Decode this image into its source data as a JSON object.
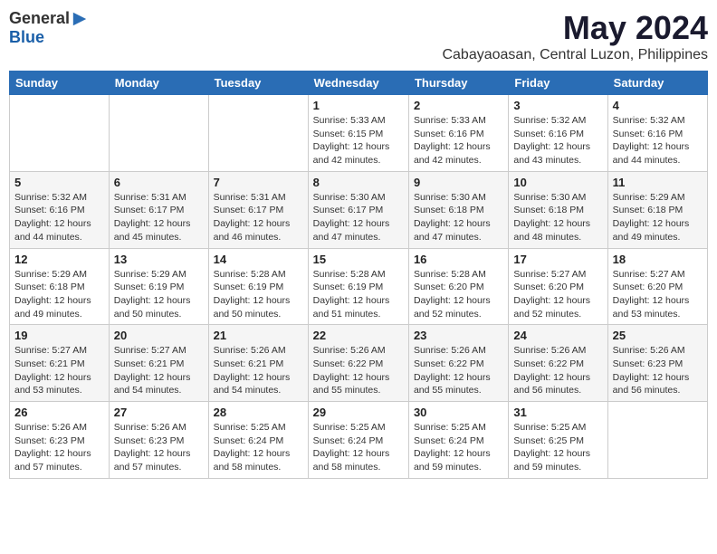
{
  "logo": {
    "general": "General",
    "blue": "Blue"
  },
  "title": "May 2024",
  "location": "Cabayaoasan, Central Luzon, Philippines",
  "weekdays": [
    "Sunday",
    "Monday",
    "Tuesday",
    "Wednesday",
    "Thursday",
    "Friday",
    "Saturday"
  ],
  "weeks": [
    [
      {
        "day": "",
        "sunrise": "",
        "sunset": "",
        "daylight": ""
      },
      {
        "day": "",
        "sunrise": "",
        "sunset": "",
        "daylight": ""
      },
      {
        "day": "",
        "sunrise": "",
        "sunset": "",
        "daylight": ""
      },
      {
        "day": "1",
        "sunrise": "Sunrise: 5:33 AM",
        "sunset": "Sunset: 6:15 PM",
        "daylight": "Daylight: 12 hours and 42 minutes."
      },
      {
        "day": "2",
        "sunrise": "Sunrise: 5:33 AM",
        "sunset": "Sunset: 6:16 PM",
        "daylight": "Daylight: 12 hours and 42 minutes."
      },
      {
        "day": "3",
        "sunrise": "Sunrise: 5:32 AM",
        "sunset": "Sunset: 6:16 PM",
        "daylight": "Daylight: 12 hours and 43 minutes."
      },
      {
        "day": "4",
        "sunrise": "Sunrise: 5:32 AM",
        "sunset": "Sunset: 6:16 PM",
        "daylight": "Daylight: 12 hours and 44 minutes."
      }
    ],
    [
      {
        "day": "5",
        "sunrise": "Sunrise: 5:32 AM",
        "sunset": "Sunset: 6:16 PM",
        "daylight": "Daylight: 12 hours and 44 minutes."
      },
      {
        "day": "6",
        "sunrise": "Sunrise: 5:31 AM",
        "sunset": "Sunset: 6:17 PM",
        "daylight": "Daylight: 12 hours and 45 minutes."
      },
      {
        "day": "7",
        "sunrise": "Sunrise: 5:31 AM",
        "sunset": "Sunset: 6:17 PM",
        "daylight": "Daylight: 12 hours and 46 minutes."
      },
      {
        "day": "8",
        "sunrise": "Sunrise: 5:30 AM",
        "sunset": "Sunset: 6:17 PM",
        "daylight": "Daylight: 12 hours and 47 minutes."
      },
      {
        "day": "9",
        "sunrise": "Sunrise: 5:30 AM",
        "sunset": "Sunset: 6:18 PM",
        "daylight": "Daylight: 12 hours and 47 minutes."
      },
      {
        "day": "10",
        "sunrise": "Sunrise: 5:30 AM",
        "sunset": "Sunset: 6:18 PM",
        "daylight": "Daylight: 12 hours and 48 minutes."
      },
      {
        "day": "11",
        "sunrise": "Sunrise: 5:29 AM",
        "sunset": "Sunset: 6:18 PM",
        "daylight": "Daylight: 12 hours and 49 minutes."
      }
    ],
    [
      {
        "day": "12",
        "sunrise": "Sunrise: 5:29 AM",
        "sunset": "Sunset: 6:18 PM",
        "daylight": "Daylight: 12 hours and 49 minutes."
      },
      {
        "day": "13",
        "sunrise": "Sunrise: 5:29 AM",
        "sunset": "Sunset: 6:19 PM",
        "daylight": "Daylight: 12 hours and 50 minutes."
      },
      {
        "day": "14",
        "sunrise": "Sunrise: 5:28 AM",
        "sunset": "Sunset: 6:19 PM",
        "daylight": "Daylight: 12 hours and 50 minutes."
      },
      {
        "day": "15",
        "sunrise": "Sunrise: 5:28 AM",
        "sunset": "Sunset: 6:19 PM",
        "daylight": "Daylight: 12 hours and 51 minutes."
      },
      {
        "day": "16",
        "sunrise": "Sunrise: 5:28 AM",
        "sunset": "Sunset: 6:20 PM",
        "daylight": "Daylight: 12 hours and 52 minutes."
      },
      {
        "day": "17",
        "sunrise": "Sunrise: 5:27 AM",
        "sunset": "Sunset: 6:20 PM",
        "daylight": "Daylight: 12 hours and 52 minutes."
      },
      {
        "day": "18",
        "sunrise": "Sunrise: 5:27 AM",
        "sunset": "Sunset: 6:20 PM",
        "daylight": "Daylight: 12 hours and 53 minutes."
      }
    ],
    [
      {
        "day": "19",
        "sunrise": "Sunrise: 5:27 AM",
        "sunset": "Sunset: 6:21 PM",
        "daylight": "Daylight: 12 hours and 53 minutes."
      },
      {
        "day": "20",
        "sunrise": "Sunrise: 5:27 AM",
        "sunset": "Sunset: 6:21 PM",
        "daylight": "Daylight: 12 hours and 54 minutes."
      },
      {
        "day": "21",
        "sunrise": "Sunrise: 5:26 AM",
        "sunset": "Sunset: 6:21 PM",
        "daylight": "Daylight: 12 hours and 54 minutes."
      },
      {
        "day": "22",
        "sunrise": "Sunrise: 5:26 AM",
        "sunset": "Sunset: 6:22 PM",
        "daylight": "Daylight: 12 hours and 55 minutes."
      },
      {
        "day": "23",
        "sunrise": "Sunrise: 5:26 AM",
        "sunset": "Sunset: 6:22 PM",
        "daylight": "Daylight: 12 hours and 55 minutes."
      },
      {
        "day": "24",
        "sunrise": "Sunrise: 5:26 AM",
        "sunset": "Sunset: 6:22 PM",
        "daylight": "Daylight: 12 hours and 56 minutes."
      },
      {
        "day": "25",
        "sunrise": "Sunrise: 5:26 AM",
        "sunset": "Sunset: 6:23 PM",
        "daylight": "Daylight: 12 hours and 56 minutes."
      }
    ],
    [
      {
        "day": "26",
        "sunrise": "Sunrise: 5:26 AM",
        "sunset": "Sunset: 6:23 PM",
        "daylight": "Daylight: 12 hours and 57 minutes."
      },
      {
        "day": "27",
        "sunrise": "Sunrise: 5:26 AM",
        "sunset": "Sunset: 6:23 PM",
        "daylight": "Daylight: 12 hours and 57 minutes."
      },
      {
        "day": "28",
        "sunrise": "Sunrise: 5:25 AM",
        "sunset": "Sunset: 6:24 PM",
        "daylight": "Daylight: 12 hours and 58 minutes."
      },
      {
        "day": "29",
        "sunrise": "Sunrise: 5:25 AM",
        "sunset": "Sunset: 6:24 PM",
        "daylight": "Daylight: 12 hours and 58 minutes."
      },
      {
        "day": "30",
        "sunrise": "Sunrise: 5:25 AM",
        "sunset": "Sunset: 6:24 PM",
        "daylight": "Daylight: 12 hours and 59 minutes."
      },
      {
        "day": "31",
        "sunrise": "Sunrise: 5:25 AM",
        "sunset": "Sunset: 6:25 PM",
        "daylight": "Daylight: 12 hours and 59 minutes."
      },
      {
        "day": "",
        "sunrise": "",
        "sunset": "",
        "daylight": ""
      }
    ]
  ]
}
